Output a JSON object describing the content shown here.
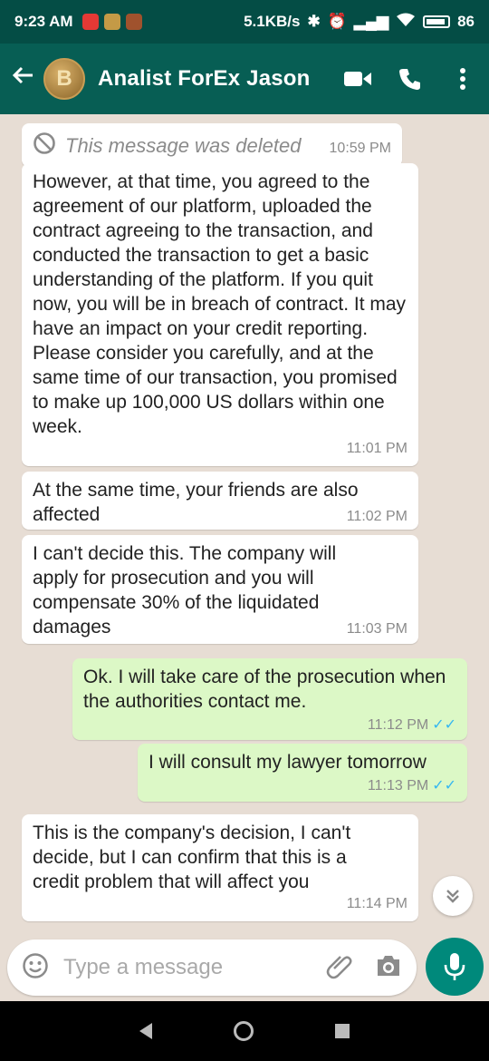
{
  "status_bar": {
    "time": "9:23 AM",
    "speed": "5.1KB/s",
    "battery": "86"
  },
  "header": {
    "contact_name": "Analist ForEx Jason",
    "avatar_glyph": "B"
  },
  "messages": [
    {
      "dir": "in",
      "deleted": true,
      "text": "This message was deleted",
      "time": "10:59 PM"
    },
    {
      "dir": "in",
      "text": "However, at that time, you agreed to the agreement of our platform, uploaded the contract agreeing to the transaction, and conducted the transaction to get a basic understanding of the platform. If you quit now, you will be in breach of contract. It may have an impact on your credit reporting. Please consider you carefully, and at the same time of our transaction, you promised to make up 100,000 US dollars within one week.",
      "time": "11:01 PM"
    },
    {
      "dir": "in",
      "text": "At the same time, your friends are also affected",
      "time": "11:02 PM"
    },
    {
      "dir": "in",
      "text": "I can't decide this. The company will apply for prosecution and you will compensate 30% of the liquidated damages",
      "time": "11:03 PM"
    },
    {
      "dir": "out",
      "text": "Ok. I will take care of the prosecution when the authorities contact me.",
      "time": "11:12 PM",
      "read": "✓✓"
    },
    {
      "dir": "out",
      "text": "I will consult my lawyer tomorrow",
      "time": "11:13 PM",
      "read": "✓✓"
    },
    {
      "dir": "in",
      "text": "This is the company's decision, I can't decide, but I can confirm that this is a credit problem that will affect you",
      "time": "11:14 PM"
    }
  ],
  "composer": {
    "placeholder": "Type a message"
  },
  "colors": {
    "header": "#075e54",
    "status": "#044d45",
    "outgoing": "#dcf8c6",
    "incoming": "#ffffff",
    "accent": "#00897b",
    "read_ticks": "#34b7f1"
  },
  "icons": {
    "back": "back-arrow-icon",
    "video": "video-call-icon",
    "phone": "phone-icon",
    "menu": "more-vert-icon",
    "emoji": "emoji-icon",
    "attach": "paperclip-icon",
    "camera": "camera-icon",
    "mic": "mic-icon",
    "deleted": "blocked-icon",
    "scroll": "double-chevron-down-icon"
  }
}
